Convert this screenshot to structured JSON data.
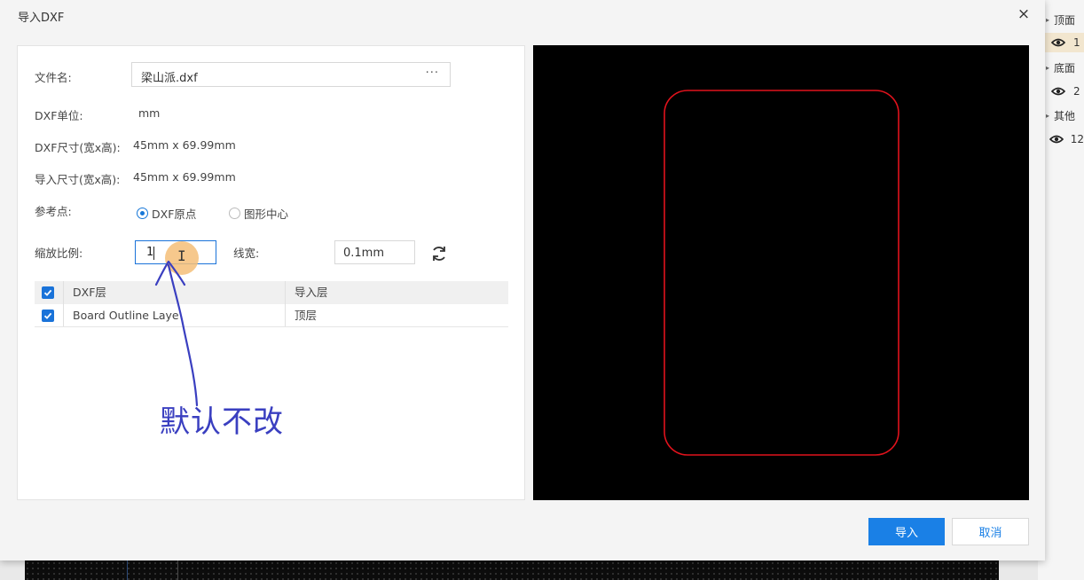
{
  "dialog": {
    "title": "导入DXF",
    "close_glyph": "×"
  },
  "form": {
    "filename_label": "文件名:",
    "filename_value": "梁山派.dxf",
    "browse_glyph": "···",
    "unit_label": "DXF单位:",
    "unit_value": "mm",
    "dxf_size_label": "DXF尺寸(宽x高):",
    "dxf_size_value": "45mm x 69.99mm",
    "import_size_label": "导入尺寸(宽x高):",
    "import_size_value": "45mm x 69.99mm",
    "ref_point_label": "参考点:",
    "ref_options": [
      {
        "label": "DXF原点",
        "selected": true
      },
      {
        "label": "图形中心",
        "selected": false
      }
    ],
    "scale_label": "缩放比例:",
    "scale_value": "1",
    "line_width_label": "线宽:",
    "line_width_value": "0.1mm"
  },
  "layer_table": {
    "headers": [
      "DXF层",
      "导入层"
    ],
    "rows": [
      {
        "dxf_layer": "Board Outline Layer",
        "import_layer": "顶层",
        "checked": true
      }
    ]
  },
  "annotation": {
    "text": "默认不改",
    "color": "#3a3fc0"
  },
  "buttons": {
    "import": "导入",
    "cancel": "取消"
  },
  "preview": {
    "outline_color": "#e0121c",
    "background": "#000000"
  },
  "layer_panel": {
    "items": [
      {
        "label": "顶面",
        "type": "group"
      },
      {
        "label": "1",
        "type": "eye",
        "highlighted": true
      },
      {
        "label": "底面",
        "type": "group"
      },
      {
        "label": "2",
        "type": "eye"
      },
      {
        "label": "其他",
        "type": "group"
      },
      {
        "label": "12",
        "type": "eye"
      }
    ]
  }
}
